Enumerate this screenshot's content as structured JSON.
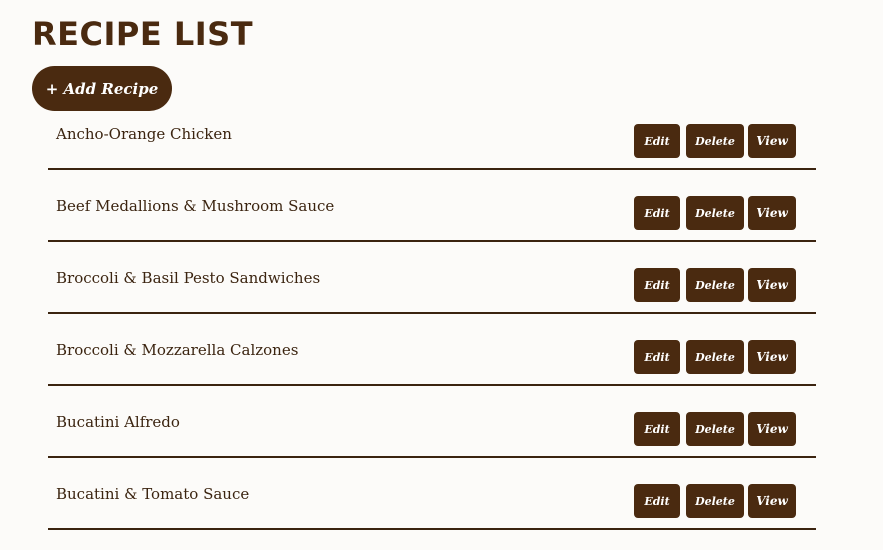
{
  "header": {
    "title": "RECIPE LIST",
    "add_button_label": "+ Add Recipe"
  },
  "recipes": [
    {
      "name": "Ancho-Orange Chicken",
      "edit_label": "Edit",
      "delete_label": "Delete",
      "view_label": "View"
    },
    {
      "name": "Beef Medallions & Mushroom Sauce",
      "edit_label": "Edit",
      "delete_label": "Delete",
      "view_label": "View"
    },
    {
      "name": "Broccoli & Basil Pesto Sandwiches",
      "edit_label": "Edit",
      "delete_label": "Delete",
      "view_label": "View"
    },
    {
      "name": "Broccoli & Mozzarella Calzones",
      "edit_label": "Edit",
      "delete_label": "Delete",
      "view_label": "View"
    },
    {
      "name": "Bucatini Alfredo",
      "edit_label": "Edit",
      "delete_label": "Delete",
      "view_label": "View"
    },
    {
      "name": "Bucatini & Tomato Sauce",
      "edit_label": "Edit",
      "delete_label": "Delete",
      "view_label": "View"
    }
  ],
  "colors": {
    "brand": "#4a2a10",
    "text": "#3b2410",
    "background": "#fcfbf9"
  }
}
